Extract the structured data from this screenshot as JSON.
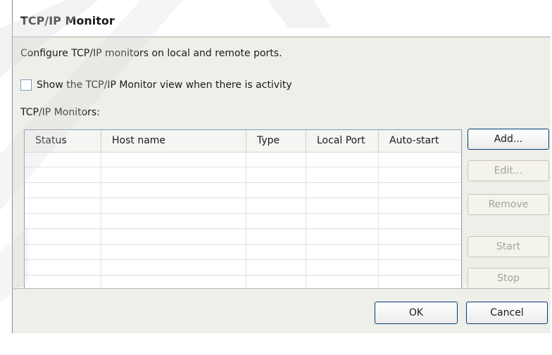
{
  "dialog": {
    "title": "TCP/IP Monitor",
    "description": "Configure TCP/IP monitors on local and remote ports.",
    "show_view_checkbox": {
      "label": "Show the TCP/IP Monitor view when there is activity",
      "checked": false
    },
    "monitors_label": "TCP/IP Monitors:",
    "table": {
      "columns": [
        "Status",
        "Host name",
        "Type",
        "Local Port",
        "Auto-start"
      ],
      "rows": []
    },
    "side_buttons": {
      "add": "Add...",
      "edit": "Edit...",
      "remove": "Remove",
      "start": "Start",
      "stop": "Stop"
    },
    "footer_buttons": {
      "ok": "OK",
      "cancel": "Cancel"
    }
  }
}
